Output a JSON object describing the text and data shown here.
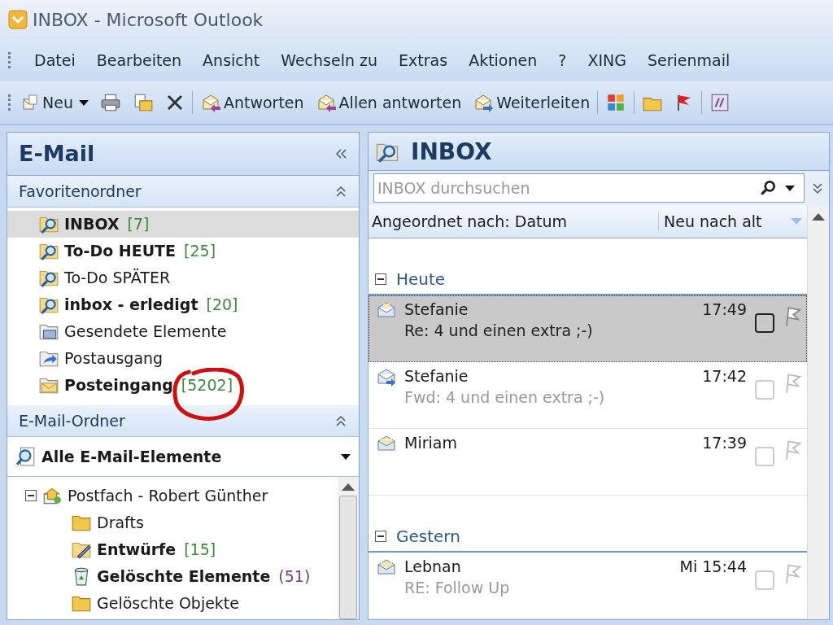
{
  "window": {
    "title": "INBOX - Microsoft Outlook"
  },
  "menu": [
    "Datei",
    "Bearbeiten",
    "Ansicht",
    "Wechseln zu",
    "Extras",
    "Aktionen",
    "?",
    "XING",
    "Serienmail"
  ],
  "toolbar": [
    {
      "kind": "new",
      "label": "Neu"
    },
    {
      "kind": "print"
    },
    {
      "kind": "move"
    },
    {
      "kind": "delete"
    },
    {
      "kind": "sep"
    },
    {
      "kind": "reply",
      "label": "Antworten"
    },
    {
      "kind": "replyall",
      "label": "Allen antworten"
    },
    {
      "kind": "forward",
      "label": "Weiterleiten"
    },
    {
      "kind": "sep"
    },
    {
      "kind": "categories"
    },
    {
      "kind": "sep"
    },
    {
      "kind": "folder"
    },
    {
      "kind": "flag"
    },
    {
      "kind": "sep"
    },
    {
      "kind": "rules"
    }
  ],
  "nav": {
    "title": "E-Mail",
    "favorites": {
      "title": "Favoritenordner",
      "items": [
        {
          "name": "INBOX",
          "count": "[7]",
          "kind": "search",
          "bold": true,
          "selected": true
        },
        {
          "name": "To-Do HEUTE",
          "count": "[25]",
          "kind": "search",
          "bold": true,
          "selected": false
        },
        {
          "name": "To-Do SPÄTER",
          "kind": "search",
          "bold": false,
          "selected": false
        },
        {
          "name": "inbox - erledigt",
          "count": "[20]",
          "kind": "search",
          "bold": true,
          "selected": false
        },
        {
          "name": "Gesendete Elemente",
          "kind": "sent",
          "bold": false,
          "selected": false
        },
        {
          "name": "Postausgang",
          "kind": "outbox",
          "bold": false,
          "selected": false
        },
        {
          "name": "Posteingang",
          "count": "[5202]",
          "kind": "inbox",
          "bold": true,
          "selected": false
        }
      ]
    },
    "folders": {
      "title": "E-Mail-Ordner",
      "view": "Alle E-Mail-Elemente",
      "tree": [
        {
          "name": "Postfach - Robert Günther",
          "kind": "mailbox",
          "bold": false,
          "expanded": true,
          "children": [
            {
              "name": "Drafts",
              "kind": "folder",
              "bold": false
            },
            {
              "name": "Entwürfe",
              "count": "[15]",
              "kind": "drafts",
              "bold": true
            },
            {
              "name": "Gelöschte Elemente",
              "count": "(51)",
              "color": "#7a3a8a",
              "kind": "trash",
              "bold": true
            },
            {
              "name": "Gelöschte Objekte",
              "kind": "folder",
              "bold": false
            }
          ]
        }
      ]
    }
  },
  "annotation": {
    "kind": "circle"
  },
  "inbox": {
    "title": "INBOX",
    "search": {
      "placeholder": "INBOX durchsuchen"
    },
    "arranged_by": "Angeordnet nach: Datum",
    "order": "Neu nach alt",
    "groups": [
      {
        "name": "Heute",
        "expanded": true,
        "messages": [
          {
            "from": "Stefanie",
            "time": "17:49",
            "subject": "Re: 4 und einen extra ;-)",
            "kind": "replied",
            "selected": true
          },
          {
            "from": "Stefanie",
            "time": "17:42",
            "subject": "Fwd: 4 und einen extra ;-)",
            "kind": "forwarded",
            "selected": false
          },
          {
            "from": "Miriam",
            "time": "17:39",
            "kind": "read",
            "selected": false
          }
        ]
      },
      {
        "name": "Gestern",
        "expanded": true,
        "messages": [
          {
            "from": "Lebnan",
            "time": "Mi 15:44",
            "subject": "RE: Follow Up",
            "kind": "read",
            "selected": false
          }
        ]
      }
    ]
  }
}
